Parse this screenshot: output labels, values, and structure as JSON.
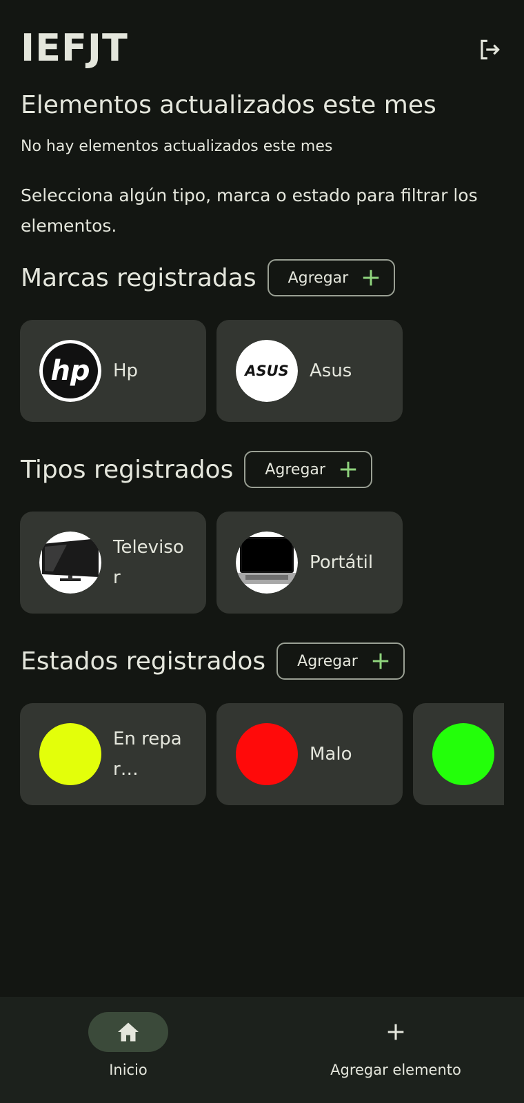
{
  "app": {
    "title": "IEFJT"
  },
  "updated": {
    "heading": "Elementos actualizados este mes",
    "empty_message": "No hay elementos actualizados este mes"
  },
  "filter_hint": "Selecciona algún tipo, marca o estado para filtrar los elementos.",
  "brands": {
    "heading": "Marcas registradas",
    "add_label": "Agregar",
    "items": [
      {
        "name": "Hp",
        "logo_text": "hp",
        "icon": "hp-logo"
      },
      {
        "name": "Asus",
        "logo_text": "ASUS",
        "icon": "asus-logo"
      }
    ]
  },
  "types": {
    "heading": "Tipos registrados",
    "add_label": "Agregar",
    "items": [
      {
        "name": "Televisor",
        "icon": "television-image"
      },
      {
        "name": "Portátil",
        "icon": "laptop-image"
      }
    ]
  },
  "states": {
    "heading": "Estados registrados",
    "add_label": "Agregar",
    "items": [
      {
        "name": "En repar…",
        "color": "#e3ff0a"
      },
      {
        "name": "Malo",
        "color": "#ff0a0a"
      },
      {
        "name": "",
        "color": "#23ff0a"
      }
    ]
  },
  "bottom_nav": {
    "items": [
      {
        "label": "Inicio",
        "icon": "home-icon",
        "active": true
      },
      {
        "label": "Agregar elemento",
        "icon": "plus-icon",
        "active": false
      }
    ]
  },
  "colors": {
    "background": "#131612",
    "card": "#333631",
    "accent": "#8fd47d",
    "nav_background": "#1c211c",
    "nav_active_pill": "#3b4a3a"
  }
}
